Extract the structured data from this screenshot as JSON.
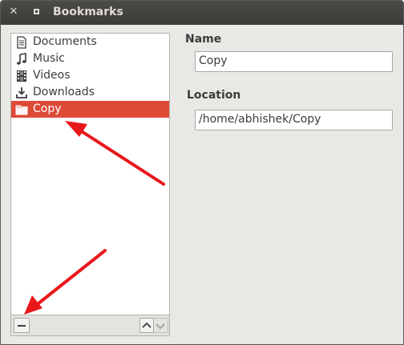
{
  "window": {
    "title": "Bookmarks"
  },
  "bookmarks": [
    {
      "label": "Documents",
      "icon": "document-icon",
      "selected": false
    },
    {
      "label": "Music",
      "icon": "music-icon",
      "selected": false
    },
    {
      "label": "Videos",
      "icon": "film-icon",
      "selected": false
    },
    {
      "label": "Downloads",
      "icon": "download-icon",
      "selected": false
    },
    {
      "label": "Copy",
      "icon": "folder-icon",
      "selected": true
    }
  ],
  "details": {
    "name_label": "Name",
    "name_value": "Copy",
    "location_label": "Location",
    "location_value": "/home/abhishek/Copy"
  },
  "colors": {
    "selection": "#dd4a38",
    "annotation_arrow": "#e8171a",
    "titlebar": "#3f3f3b"
  }
}
